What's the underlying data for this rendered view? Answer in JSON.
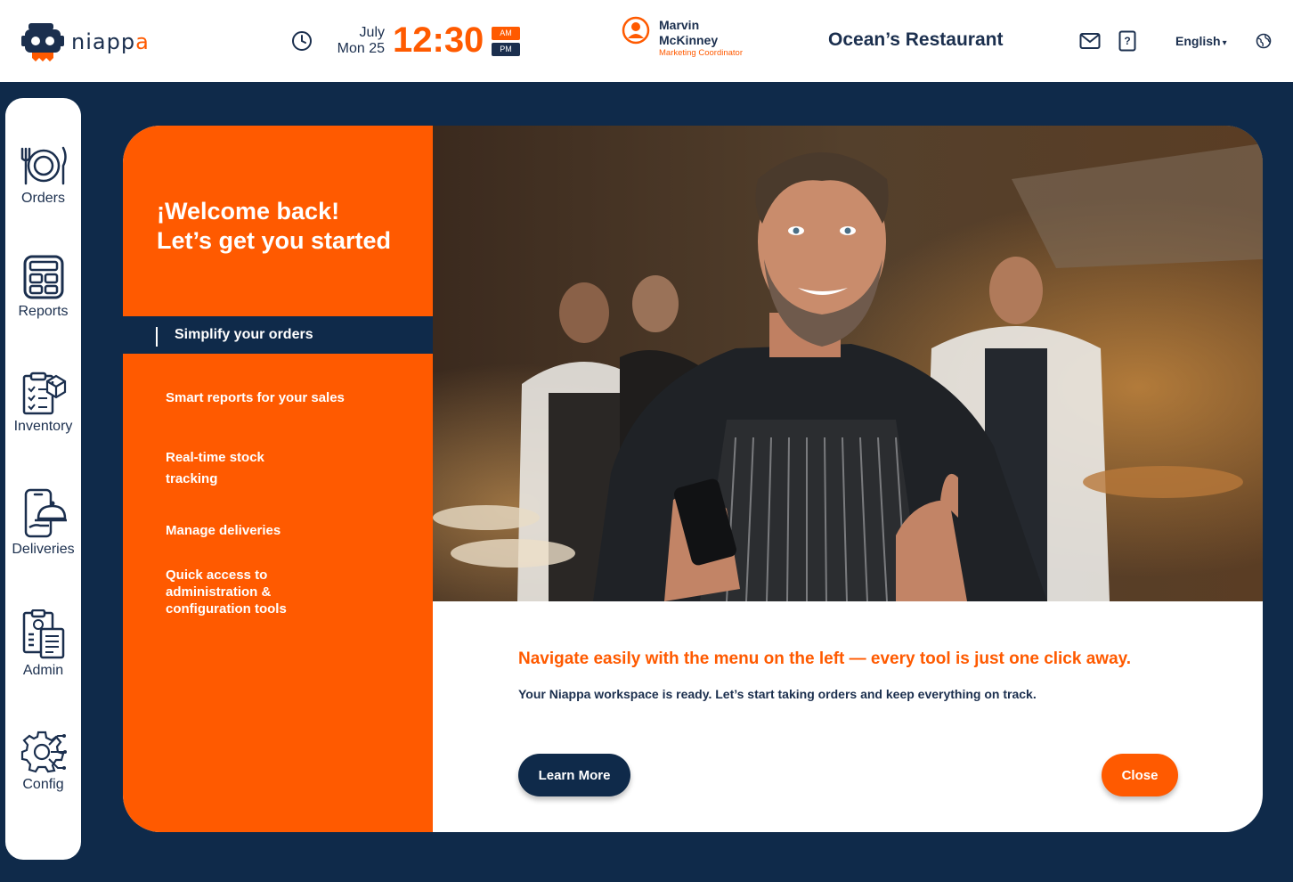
{
  "brand": {
    "logo_text": "niappa",
    "logo_accent": "a",
    "logo_prefix": "niapp"
  },
  "header": {
    "month": "July",
    "day": "Mon 25",
    "time": "12:30",
    "am": "AM",
    "pm": "PM",
    "user_first": "Marvin",
    "user_last": "McKinney",
    "user_role": "Marketing Coordinator",
    "restaurant": "Ocean’s Restaurant",
    "language": "English",
    "language_caret": "▾"
  },
  "sidebar": {
    "items": [
      {
        "label": "Orders",
        "icon": "plate-cutlery-icon"
      },
      {
        "label": "Reports",
        "icon": "calculator-icon"
      },
      {
        "label": "Inventory",
        "icon": "clipboard-box-icon"
      },
      {
        "label": "Deliveries",
        "icon": "phone-cloche-icon"
      },
      {
        "label": "Admin",
        "icon": "admin-documents-icon"
      },
      {
        "label": "Config",
        "icon": "gear-circuit-icon"
      }
    ]
  },
  "welcome": {
    "line1": "¡Welcome back!",
    "line2": "Let’s get you started",
    "active": "Simplify your orders",
    "items": [
      "Smart reports for your sales",
      "Real-time stock tracking",
      "Manage deliveries",
      "Quick access to administration & configuration tools"
    ],
    "headline": "Navigate easily with the menu on the left — every tool is just one click away.",
    "subtext": "Your Niappa workspace is ready. Let’s start taking orders and keep everything on track.",
    "learn_more": "Learn More",
    "close": "Close"
  },
  "colors": {
    "accent": "#ff5a00",
    "navy": "#0f2a4a",
    "text": "#1b2f4e"
  }
}
